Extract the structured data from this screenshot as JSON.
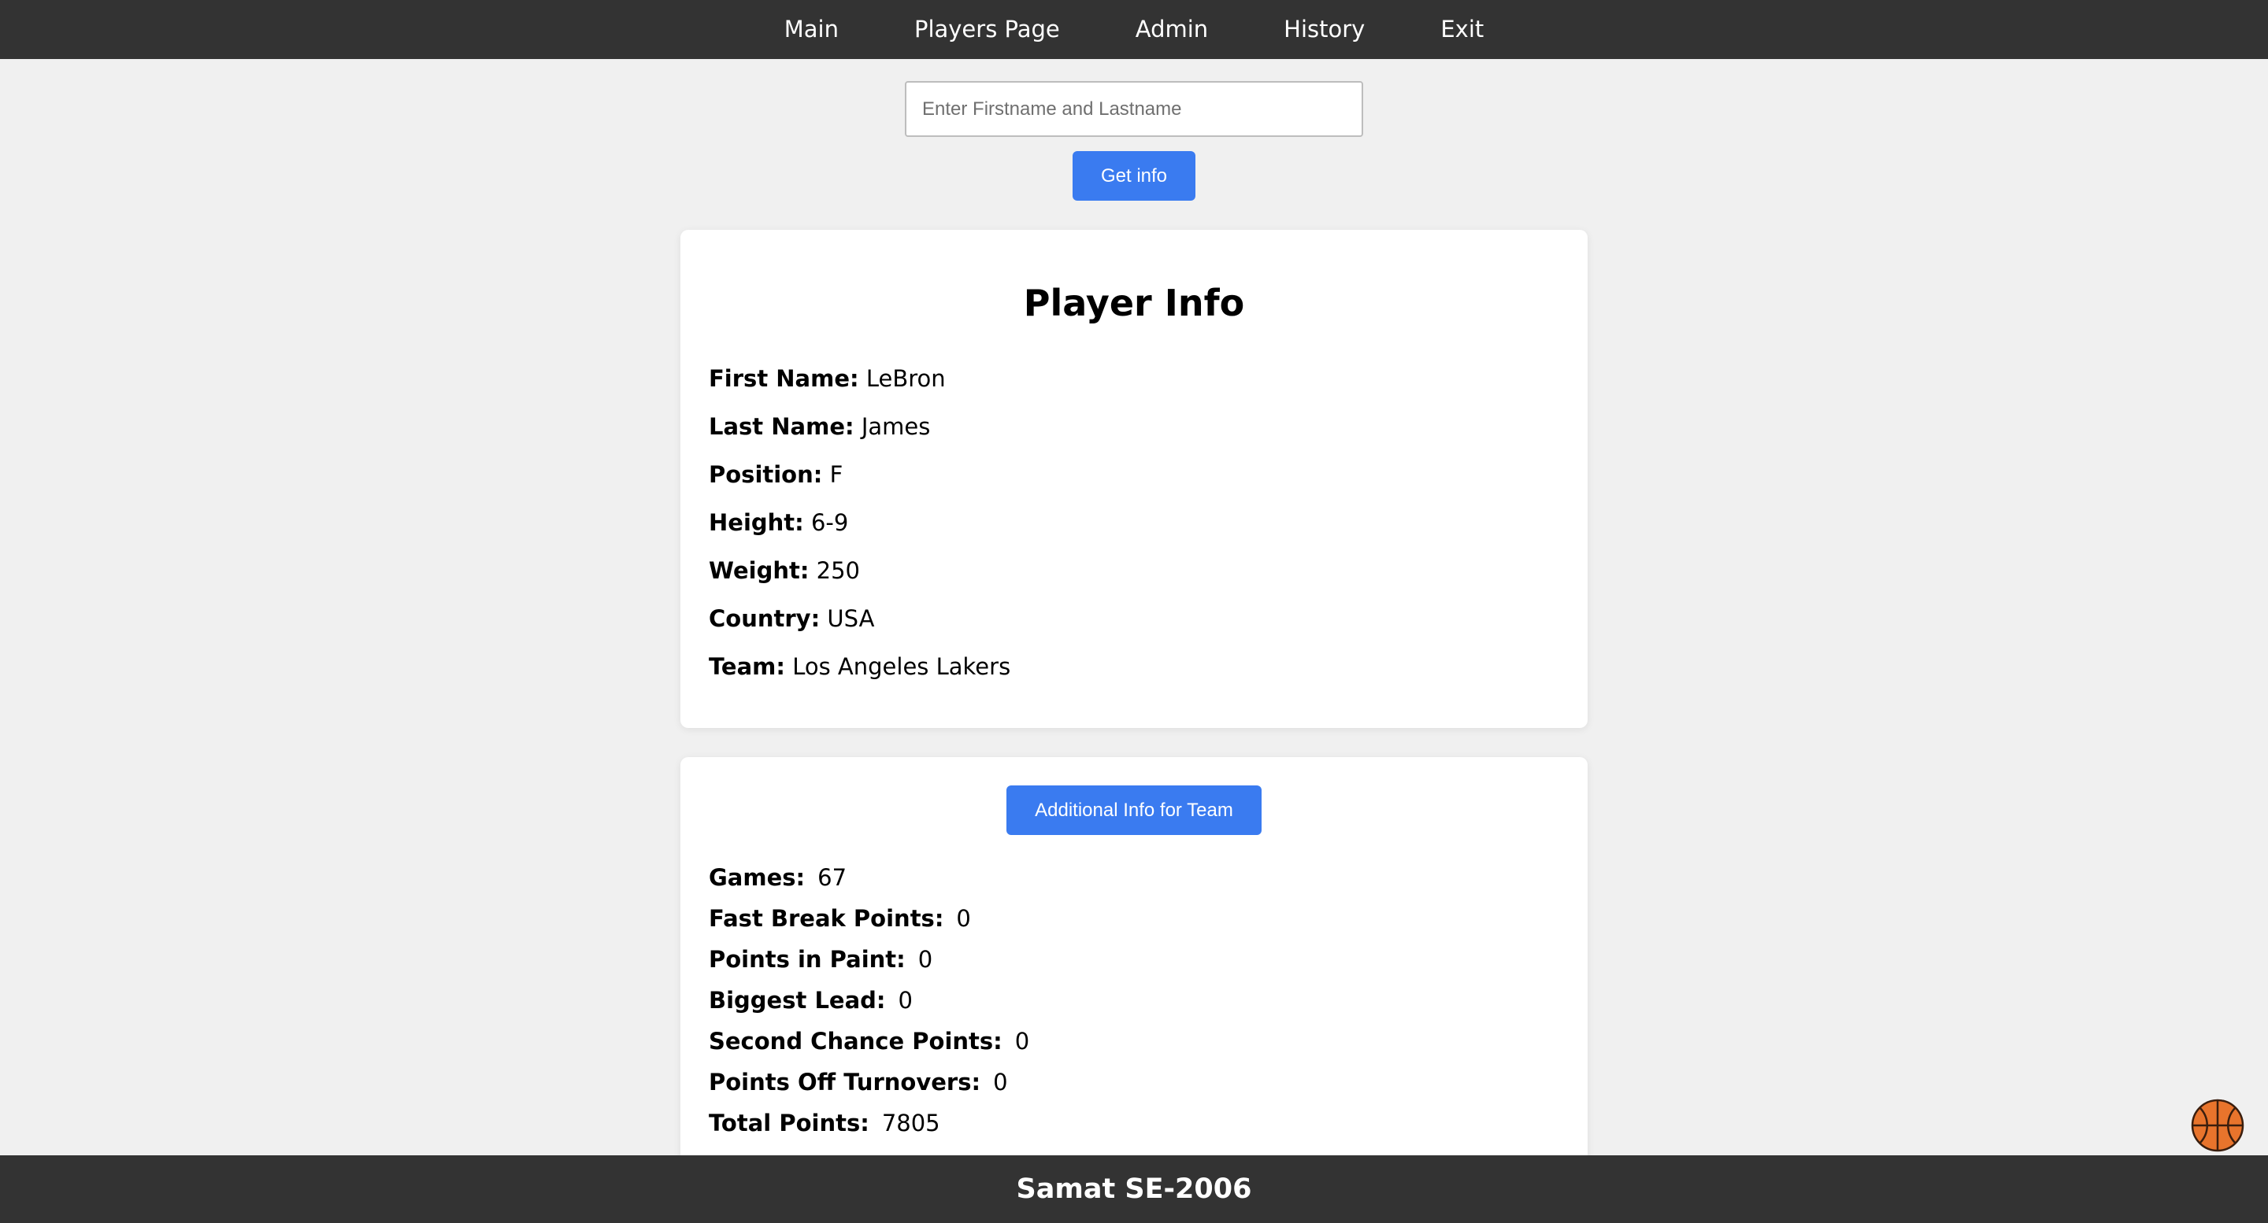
{
  "nav": {
    "items": [
      "Main",
      "Players Page",
      "Admin",
      "History",
      "Exit"
    ]
  },
  "search": {
    "placeholder": "Enter Firstname and Lastname",
    "value": "",
    "button_label": "Get info"
  },
  "player_info": {
    "title": "Player Info",
    "fields": [
      {
        "label": "First Name:",
        "value": "LeBron"
      },
      {
        "label": "Last Name:",
        "value": "James"
      },
      {
        "label": "Position:",
        "value": "F"
      },
      {
        "label": "Height:",
        "value": "6-9"
      },
      {
        "label": "Weight:",
        "value": "250"
      },
      {
        "label": "Country:",
        "value": "USA"
      },
      {
        "label": "Team:",
        "value": "Los Angeles Lakers"
      }
    ]
  },
  "team_info": {
    "button_label": "Additional Info for Team",
    "stats": [
      {
        "label": "Games:",
        "value": "67"
      },
      {
        "label": "Fast Break Points:",
        "value": "0"
      },
      {
        "label": "Points in Paint:",
        "value": "0"
      },
      {
        "label": "Biggest Lead:",
        "value": "0"
      },
      {
        "label": "Second Chance Points:",
        "value": "0"
      },
      {
        "label": "Points Off Turnovers:",
        "value": "0"
      },
      {
        "label": "Total Points:",
        "value": "7805"
      }
    ]
  },
  "footer": {
    "text": "Samat SE-2006"
  },
  "colors": {
    "nav_bg": "#333333",
    "button_blue": "#3a7bf0",
    "page_bg": "#f0f0f0"
  },
  "icons": {
    "floating": "basketball-icon"
  }
}
